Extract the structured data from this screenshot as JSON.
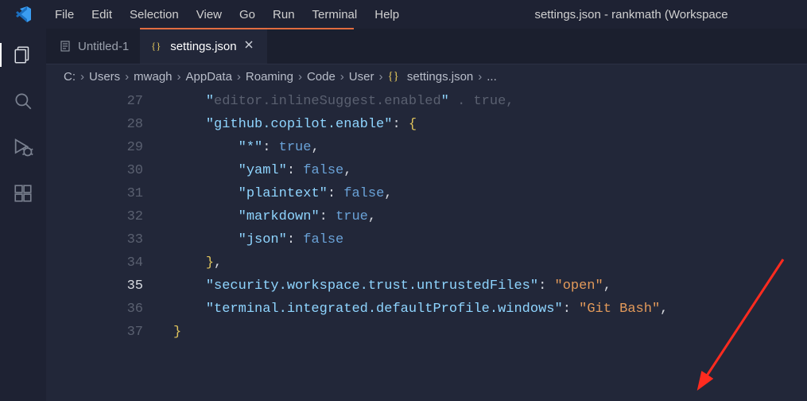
{
  "title": "settings.json - rankmath (Workspace",
  "menu": [
    "File",
    "Edit",
    "Selection",
    "View",
    "Go",
    "Run",
    "Terminal",
    "Help"
  ],
  "tabs": [
    {
      "label": "Untitled-1",
      "iconKind": "text",
      "active": false,
      "dirty": false
    },
    {
      "label": "settings.json",
      "iconKind": "json",
      "active": true,
      "dirty": false
    }
  ],
  "breadcrumb": [
    "C:",
    "Users",
    "mwagh",
    "AppData",
    "Roaming",
    "Code",
    "User",
    "settings.json",
    "..."
  ],
  "breadcrumb_icon_index": 7,
  "gutter": [
    "27",
    "28",
    "29",
    "30",
    "31",
    "32",
    "33",
    "34",
    "35",
    "36",
    "37"
  ],
  "current_line_index": 8,
  "code": {
    "l27_key": "editor.inlineSuggest.enabled",
    "l27_after": " . true,",
    "l28_key": "github.copilot.enable",
    "l29_key": "*",
    "l29_val": "true",
    "l30_key": "yaml",
    "l30_val": "false",
    "l31_key": "plaintext",
    "l31_val": "false",
    "l32_key": "markdown",
    "l32_val": "true",
    "l33_key": "json",
    "l33_val": "false",
    "l35_key": "security.workspace.trust.untrustedFiles",
    "l35_val": "open",
    "l36_key": "terminal.integrated.defaultProfile.windows",
    "l36_val": "Git Bash"
  }
}
